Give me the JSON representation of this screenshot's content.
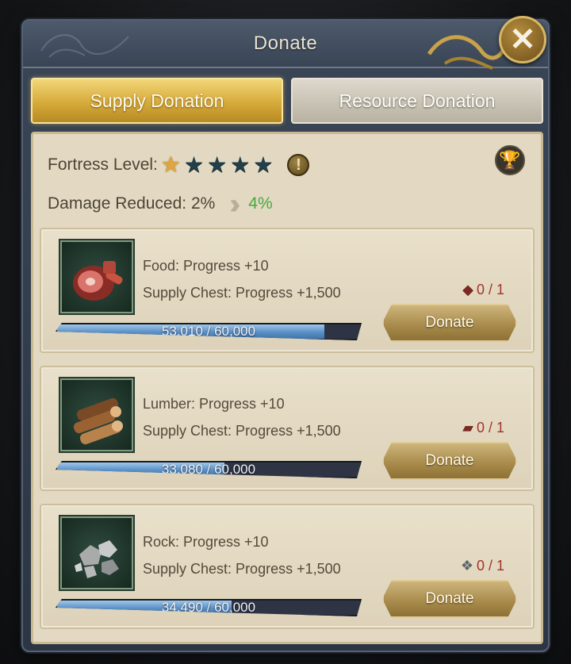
{
  "dialog": {
    "title": "Donate",
    "close_icon": "close-x-icon"
  },
  "tabs": [
    {
      "label": "Supply Donation",
      "active": true
    },
    {
      "label": "Resource Donation",
      "active": false
    }
  ],
  "fortress": {
    "label": "Fortress Level:",
    "stars_total": 5,
    "stars_filled": 1,
    "info_icon": "exclamation-icon",
    "trophy_icon": "trophy-icon"
  },
  "damage": {
    "label": "Damage Reduced: 2%",
    "next": "4%"
  },
  "donations": [
    {
      "resource": "food",
      "icon": "meat-icon",
      "line1": "Food: Progress +10",
      "line2": "Supply Chest: Progress +1,500",
      "count": "0 / 1",
      "count_icon": "meat-token-icon",
      "progress_text": "53,010 / 60,000",
      "progress_fraction": 0.8835,
      "button": "Donate"
    },
    {
      "resource": "lumber",
      "icon": "logs-icon",
      "line1": "Lumber: Progress +10",
      "line2": "Supply Chest: Progress +1,500",
      "count": "0 / 1",
      "count_icon": "log-token-icon",
      "progress_text": "33,080 / 60,000",
      "progress_fraction": 0.5513,
      "button": "Donate"
    },
    {
      "resource": "rock",
      "icon": "stones-icon",
      "line1": "Rock: Progress +10",
      "line2": "Supply Chest: Progress +1,500",
      "count": "0 / 1",
      "count_icon": "stone-token-icon",
      "progress_text": "34,490 / 60,000",
      "progress_fraction": 0.5748,
      "button": "Donate"
    }
  ],
  "colors": {
    "accent_gold": "#d6aa3a",
    "progress_blue": "#5a8fc6",
    "bonus_green": "#47a83e",
    "count_red": "#a2342a"
  }
}
